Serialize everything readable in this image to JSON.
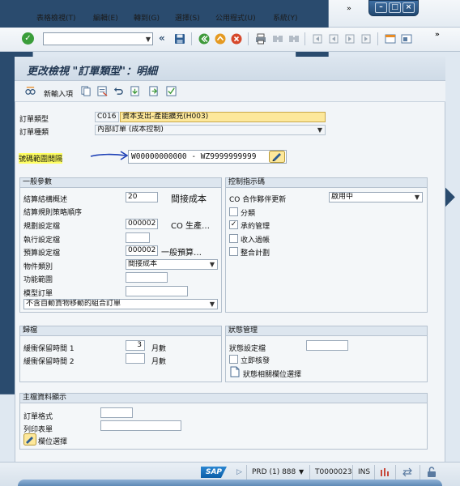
{
  "menu": {
    "items": [
      {
        "label": "表格檢視(T)"
      },
      {
        "label": "編輯(E)"
      },
      {
        "label": "轉到(G)"
      },
      {
        "label": "選擇(S)"
      },
      {
        "label": "公用程式(U)"
      },
      {
        "label": "系統(Y)"
      }
    ],
    "more": "»"
  },
  "toolbar": {
    "command_value": "",
    "more": "»"
  },
  "page": {
    "title": "更改檢視 \"訂單類型\"：明細",
    "new_entry_label": "新輸入項"
  },
  "header": {
    "order_type_label": "訂單類型",
    "order_type_code": "C016",
    "order_type_desc": "資本支出-產能擴充(H003)",
    "order_category_label": "訂單種類",
    "order_category_value": "內部訂單 (成本控制)",
    "number_range_label": "號碼範圍間隔",
    "number_range_value": "W00000000000 - WZ9999999999"
  },
  "general": {
    "title": "一般參數",
    "settlement_profile_label": "結算結構概述",
    "settlement_profile_value": "20",
    "settlement_profile_text": "間接成本",
    "settlement_rule_label": "結算規則策略順序",
    "planning_profile_label": "規劃設定檔",
    "planning_profile_value": "000002",
    "planning_profile_text": "CO 生產…",
    "execution_profile_label": "執行設定檔",
    "execution_profile_value": "",
    "budget_profile_label": "預算設定檔",
    "budget_profile_value": "000002",
    "budget_profile_text": "一般預算…",
    "object_class_label": "物件類別",
    "object_class_value": "間接成本",
    "functional_area_label": "功能範圍",
    "model_order_label": "模型訂單",
    "goods_movement_value": "不含自動貨物移動的組合訂單"
  },
  "control": {
    "title": "控制指示碼",
    "co_partner_label": "CO 合作夥伴更新",
    "co_partner_value": "啟用中",
    "options": [
      {
        "label": "分類",
        "checked": false
      },
      {
        "label": "承約管理",
        "checked": true
      },
      {
        "label": "收入過帳",
        "checked": false
      },
      {
        "label": "整合計劃",
        "checked": false
      }
    ]
  },
  "archiving": {
    "title": "歸檔",
    "residence1_label": "緩衝保留時間 1",
    "residence1_value": "3",
    "residence1_unit": "月數",
    "residence2_label": "緩衝保留時間 2",
    "residence2_value": "",
    "residence2_unit": "月數"
  },
  "status_mgmt": {
    "title": "狀態管理",
    "status_profile_label": "狀態設定檔",
    "status_profile_value": "",
    "release_immediately_label": "立即核發",
    "status_selection_label": "狀態相關欄位選擇"
  },
  "master_data": {
    "title": "主檔資料顯示",
    "order_layout_label": "訂單格式",
    "order_layout_value": "",
    "print_form_label": "列印表單",
    "print_form_value": "",
    "field_selection_label": "欄位選擇"
  },
  "status_bar": {
    "logo": "SAP",
    "system": "PRD (1) 888",
    "server": "T0000023",
    "mode": "INS"
  }
}
